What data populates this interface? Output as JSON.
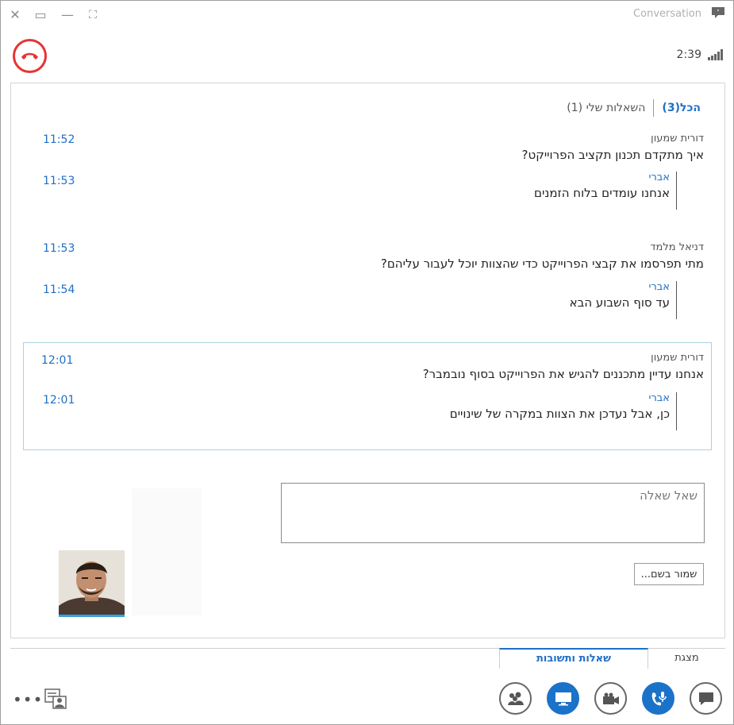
{
  "window": {
    "title": "Conversation",
    "close_glyph": "✕",
    "restore_glyph": "▭",
    "minimize_glyph": "—",
    "fullscreen_glyph": "⛶"
  },
  "call": {
    "timer": "2:39",
    "hangup_color": "#e63434"
  },
  "filters": {
    "all_label": "הכל(3)",
    "mine_label": "השאלות שלי (1)"
  },
  "questions": [
    {
      "author": "דורית שמעון",
      "text": "איך מתקדם תכנון תקציב הפרוייקט?",
      "time": "11:52",
      "answer": {
        "author": "אברי",
        "text": "אנחנו עומדים בלוח הזמנים",
        "time": "11:53"
      }
    },
    {
      "author": "דניאל מלמד",
      "text": "מתי תפרסמו את קבצי הפרוייקט כדי שהצוות יוכל לעבור עליהם?",
      "time": "11:53",
      "answer": {
        "author": "אברי",
        "text": "עד סוף השבוע הבא",
        "time": "11:54"
      }
    },
    {
      "author": "דורית שמעון",
      "text": "אנחנו עדיין מתכננים להגיש את הפרוייקט בסוף נובמבר?",
      "time": "12:01",
      "answer": {
        "author": "אברי",
        "text": "כן, אבל נעדכן את הצוות במקרה של שינויים",
        "time": "12:01"
      }
    }
  ],
  "ask": {
    "placeholder": "שאל שאלה"
  },
  "save_button": "שמור בשם...",
  "tabs": {
    "presentation": "מצגת",
    "qa": "שאלות ותשובות"
  },
  "toolbar": {
    "more_glyph": "•••"
  },
  "colors": {
    "accent": "#1f6fc5",
    "button_blue": "#1a73c8"
  }
}
